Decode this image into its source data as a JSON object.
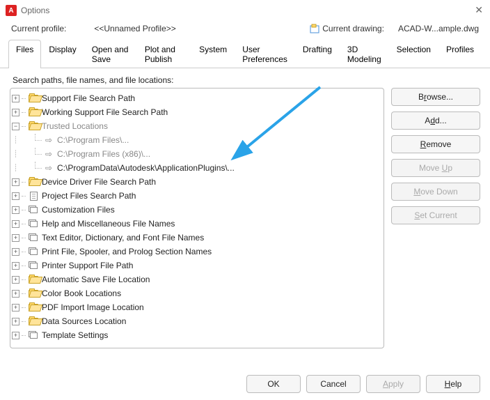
{
  "window": {
    "title": "Options"
  },
  "profile": {
    "label": "Current profile:",
    "value": "<<Unnamed Profile>>",
    "drawing_label": "Current drawing:",
    "drawing_value": "ACAD-W...ample.dwg"
  },
  "tabs": {
    "items": [
      "Files",
      "Display",
      "Open and Save",
      "Plot and Publish",
      "System",
      "User Preferences",
      "Drafting",
      "3D Modeling",
      "Selection",
      "Profiles"
    ],
    "active": "Files"
  },
  "description": "Search paths, file names, and file locations:",
  "tree": [
    {
      "type": "folder",
      "expand": "plus",
      "label": "Support File Search Path",
      "open": true
    },
    {
      "type": "folder",
      "expand": "plus",
      "label": "Working Support File Search Path",
      "open": true
    },
    {
      "type": "folder",
      "expand": "minus",
      "label": "Trusted Locations",
      "open": true,
      "gray": true,
      "children": [
        {
          "type": "path",
          "label": "C:\\Program Files\\...",
          "gray": true
        },
        {
          "type": "path",
          "label": "C:\\Program Files (x86)\\...",
          "gray": true
        },
        {
          "type": "path",
          "label": "C:\\ProgramData\\Autodesk\\ApplicationPlugins\\...",
          "gray": false,
          "highlight": true
        }
      ]
    },
    {
      "type": "folder",
      "expand": "plus",
      "label": "Device Driver File Search Path",
      "open": true
    },
    {
      "type": "doc",
      "expand": "plus",
      "label": "Project Files Search Path"
    },
    {
      "type": "stack",
      "expand": "plus",
      "label": "Customization Files"
    },
    {
      "type": "stack",
      "expand": "plus",
      "label": "Help and Miscellaneous File Names"
    },
    {
      "type": "stack",
      "expand": "plus",
      "label": "Text Editor, Dictionary, and Font File Names"
    },
    {
      "type": "stack",
      "expand": "plus",
      "label": "Print File, Spooler, and Prolog Section Names"
    },
    {
      "type": "stack",
      "expand": "plus",
      "label": "Printer Support File Path"
    },
    {
      "type": "folder",
      "expand": "plus",
      "label": "Automatic Save File Location",
      "open": true
    },
    {
      "type": "folder",
      "expand": "plus",
      "label": "Color Book Locations",
      "open": true
    },
    {
      "type": "folder",
      "expand": "plus",
      "label": "PDF Import Image Location",
      "open": true
    },
    {
      "type": "folder",
      "expand": "plus",
      "label": "Data Sources Location",
      "open": true
    },
    {
      "type": "stack",
      "expand": "plus",
      "label": "Template Settings"
    }
  ],
  "buttons": {
    "browse": {
      "pre": "B",
      "u": "r",
      "post": "owse..."
    },
    "add": {
      "pre": "A",
      "u": "d",
      "post": "d..."
    },
    "remove": {
      "u": "R",
      "post": "emove"
    },
    "moveup": {
      "pre": "Move ",
      "u": "U",
      "post": "p"
    },
    "movedown": {
      "pre": "",
      "u": "M",
      "post": "ove Down"
    },
    "setcurrent": {
      "u": "S",
      "post": "et Current"
    }
  },
  "bottom": {
    "ok": "OK",
    "cancel": "Cancel",
    "apply": {
      "u": "A",
      "post": "pply"
    },
    "help": {
      "u": "H",
      "post": "elp"
    }
  },
  "annotation": {
    "color": "#2aa3e8"
  }
}
